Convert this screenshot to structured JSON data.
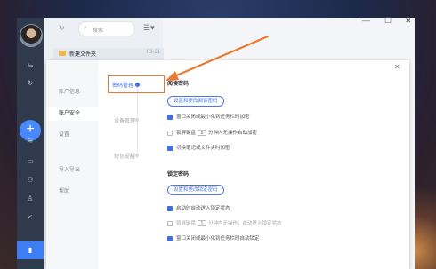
{
  "search": {
    "placeholder": "搜索"
  },
  "file_list": {
    "folder_name": "新建文件夹",
    "folder_date": "03-21"
  },
  "settings": {
    "nav": [
      "账户信息",
      "账户安全",
      "设置",
      "导入导出",
      "帮助"
    ],
    "nav_active": "账户安全",
    "steps": [
      "密码管理",
      "设备管理",
      "短信提醒"
    ],
    "reading_password": {
      "title": "阅读密码",
      "button": "设置和更改阅读密码",
      "options": [
        {
          "checked": true,
          "text": "窗口关闭或最小化到任务栏时加密"
        },
        {
          "checked": false,
          "pre": "锁屏键盘",
          "value": "5",
          "post": "分钟内无操作自动加密"
        },
        {
          "checked": true,
          "text": "切换笔记或文件夹时加密"
        }
      ]
    },
    "lock_password": {
      "title": "锁定密码",
      "button": "设置和更改锁定密码",
      "options": [
        {
          "checked": true,
          "text": "启动时自动进入锁定状态"
        },
        {
          "checked": false,
          "pre": "锁屏键盘",
          "value": "5",
          "post": "分钟内无操作，自动进入锁定状态"
        },
        {
          "checked": true,
          "text": "窗口关闭或最小化到任务栏时自动锁定"
        }
      ]
    }
  },
  "colors": {
    "accent": "#3d6fe8",
    "highlight": "#ea7b2c",
    "sidebar": "#2f3a4c"
  }
}
